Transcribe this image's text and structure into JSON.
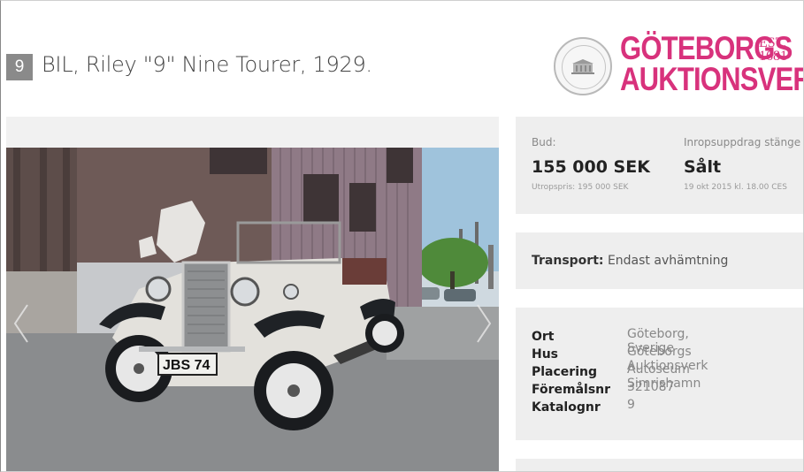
{
  "lot": {
    "number": "9",
    "title": "BIL, Riley \"9\" Nine Tourer, 1929."
  },
  "brand": {
    "line1": "GÖTEBORGS",
    "line2": "AUKTIONSVERK",
    "est_line1": "EST.",
    "est_line2": "1681",
    "color": "#d8327c"
  },
  "bid": {
    "label": "Bud:",
    "value": "155 000 SEK",
    "estimate": "Utropspris: 195 000 SEK"
  },
  "status": {
    "label": "Inropsuppdrag stänge",
    "value": "Sålt",
    "date": "19 okt 2015 kl. 18.00 CES"
  },
  "transport": {
    "label": "Transport:",
    "value": "Endast avhämtning"
  },
  "details": [
    {
      "key": "Ort",
      "value": "Göteborg, Sverige"
    },
    {
      "key": "Hus",
      "value": "Göteborgs Auktionsverk"
    },
    {
      "key": "Placering",
      "value": "Autoseum Simrishamn"
    },
    {
      "key": "Föremålsnr",
      "value": "321087"
    },
    {
      "key": "Katalognr",
      "value": "9"
    }
  ],
  "photo": {
    "plate": "JBS 74"
  },
  "icons": {
    "prev": "chevron-left-icon",
    "next": "chevron-right-icon"
  }
}
